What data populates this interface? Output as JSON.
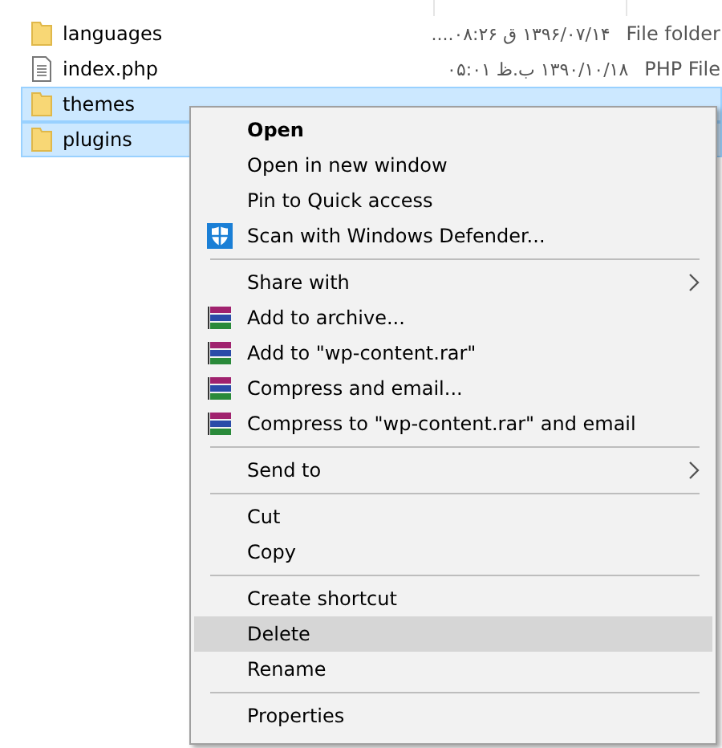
{
  "files": [
    {
      "name": "languages",
      "type": "File folder",
      "modified": "۱۳۹۶/۰۷/۱۴ ق ۰۸:۲۶....",
      "kind": "folder",
      "selected": false
    },
    {
      "name": "index.php",
      "type": "PHP File",
      "modified": "۱۳۹۰/۱۰/۱۸ ب.ظ ۰۵:۰۱",
      "kind": "document",
      "selected": false
    },
    {
      "name": "themes",
      "kind": "folder",
      "selected": true
    },
    {
      "name": "plugins",
      "kind": "folder",
      "selected": true
    }
  ],
  "context_menu": [
    {
      "kind": "item",
      "label": "Open",
      "bold": true,
      "selected": false
    },
    {
      "kind": "item",
      "label": "Open in new window",
      "selected": false
    },
    {
      "kind": "item",
      "label": "Pin to Quick access",
      "selected": false
    },
    {
      "kind": "shield",
      "label": "Scan with Windows Defender...",
      "selected": false
    },
    {
      "kind": "separator"
    },
    {
      "kind": "item",
      "label": "Share with",
      "submenu": true,
      "selected": false
    },
    {
      "kind": "archive",
      "label": "Add to archive...",
      "selected": false
    },
    {
      "kind": "archive",
      "label": "Add to \"wp-content.rar\"",
      "selected": false
    },
    {
      "kind": "archive",
      "label": "Compress and email...",
      "selected": false
    },
    {
      "kind": "archive",
      "label": "Compress to \"wp-content.rar\" and email",
      "selected": false
    },
    {
      "kind": "separator"
    },
    {
      "kind": "item",
      "label": "Send to",
      "submenu": true,
      "selected": false
    },
    {
      "kind": "separator"
    },
    {
      "kind": "item",
      "label": "Cut",
      "selected": false
    },
    {
      "kind": "item",
      "label": "Copy",
      "selected": false
    },
    {
      "kind": "separator"
    },
    {
      "kind": "item",
      "label": "Create shortcut",
      "selected": false
    },
    {
      "kind": "item",
      "label": "Delete",
      "selected": true
    },
    {
      "kind": "item",
      "label": "Rename",
      "selected": false
    },
    {
      "kind": "separator"
    },
    {
      "kind": "item",
      "label": "Properties",
      "selected": false
    }
  ]
}
